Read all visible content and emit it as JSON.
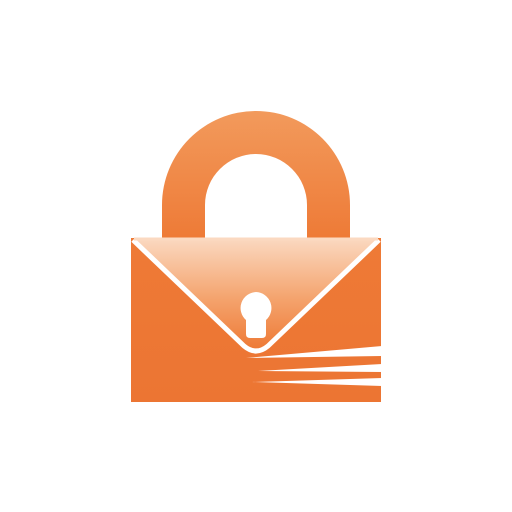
{
  "logo": {
    "icon": "padlock-envelope-icon",
    "colors": {
      "primary": "#EE7A36",
      "light": "#F6B58A",
      "highlight": "#FBD9C1",
      "background": "#FFFFFF",
      "line": "#FFFFFF"
    }
  }
}
